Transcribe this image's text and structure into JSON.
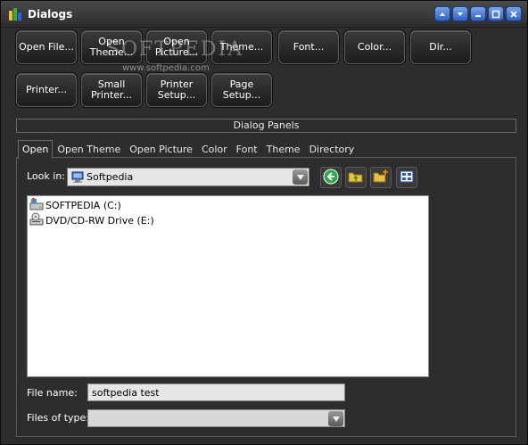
{
  "window": {
    "title": "Dialogs",
    "controls": [
      "restore-up-icon",
      "restore-down-icon",
      "minimize-icon",
      "maximize-icon",
      "close-icon"
    ]
  },
  "watermark": {
    "brand": "SOFTPEDIA",
    "url": "www.softpedia.com"
  },
  "buttons": {
    "open_file": "Open File...",
    "open_theme": "Open Theme...",
    "open_picture": "Open Picture...",
    "theme": "Theme...",
    "font": "Font...",
    "color": "Color...",
    "dir": "Dir...",
    "printer": "Printer...",
    "small_printer": "Small Printer...",
    "printer_setup": "Printer Setup...",
    "page_setup": "Page Setup..."
  },
  "group": {
    "label": "Dialog Panels"
  },
  "tabs": [
    {
      "label": "Open",
      "active": true
    },
    {
      "label": "Open Theme",
      "active": false
    },
    {
      "label": "Open Picture",
      "active": false
    },
    {
      "label": "Color",
      "active": false
    },
    {
      "label": "Font",
      "active": false
    },
    {
      "label": "Theme",
      "active": false
    },
    {
      "label": "Directory",
      "active": false
    }
  ],
  "open_panel": {
    "look_in_label": "Look in:",
    "look_in_value": "Softpedia",
    "toolbar": [
      "back-icon",
      "up-folder-icon",
      "new-folder-icon",
      "view-menu-icon"
    ],
    "files": [
      {
        "name": "SOFTPEDIA (C:)",
        "icon": "hard-drive-icon"
      },
      {
        "name": "DVD/CD-RW Drive (E:)",
        "icon": "cd-drive-icon"
      }
    ],
    "file_name_label": "File name:",
    "file_name_value": "softpedia test",
    "file_type_label": "Files of type:",
    "file_type_value": ""
  },
  "colors": {
    "window_bg": "#2d2d2d",
    "button_bg": "#1c1c1c",
    "titlebar_button": "#3d6fd4",
    "back_button": "#2aa84a"
  }
}
